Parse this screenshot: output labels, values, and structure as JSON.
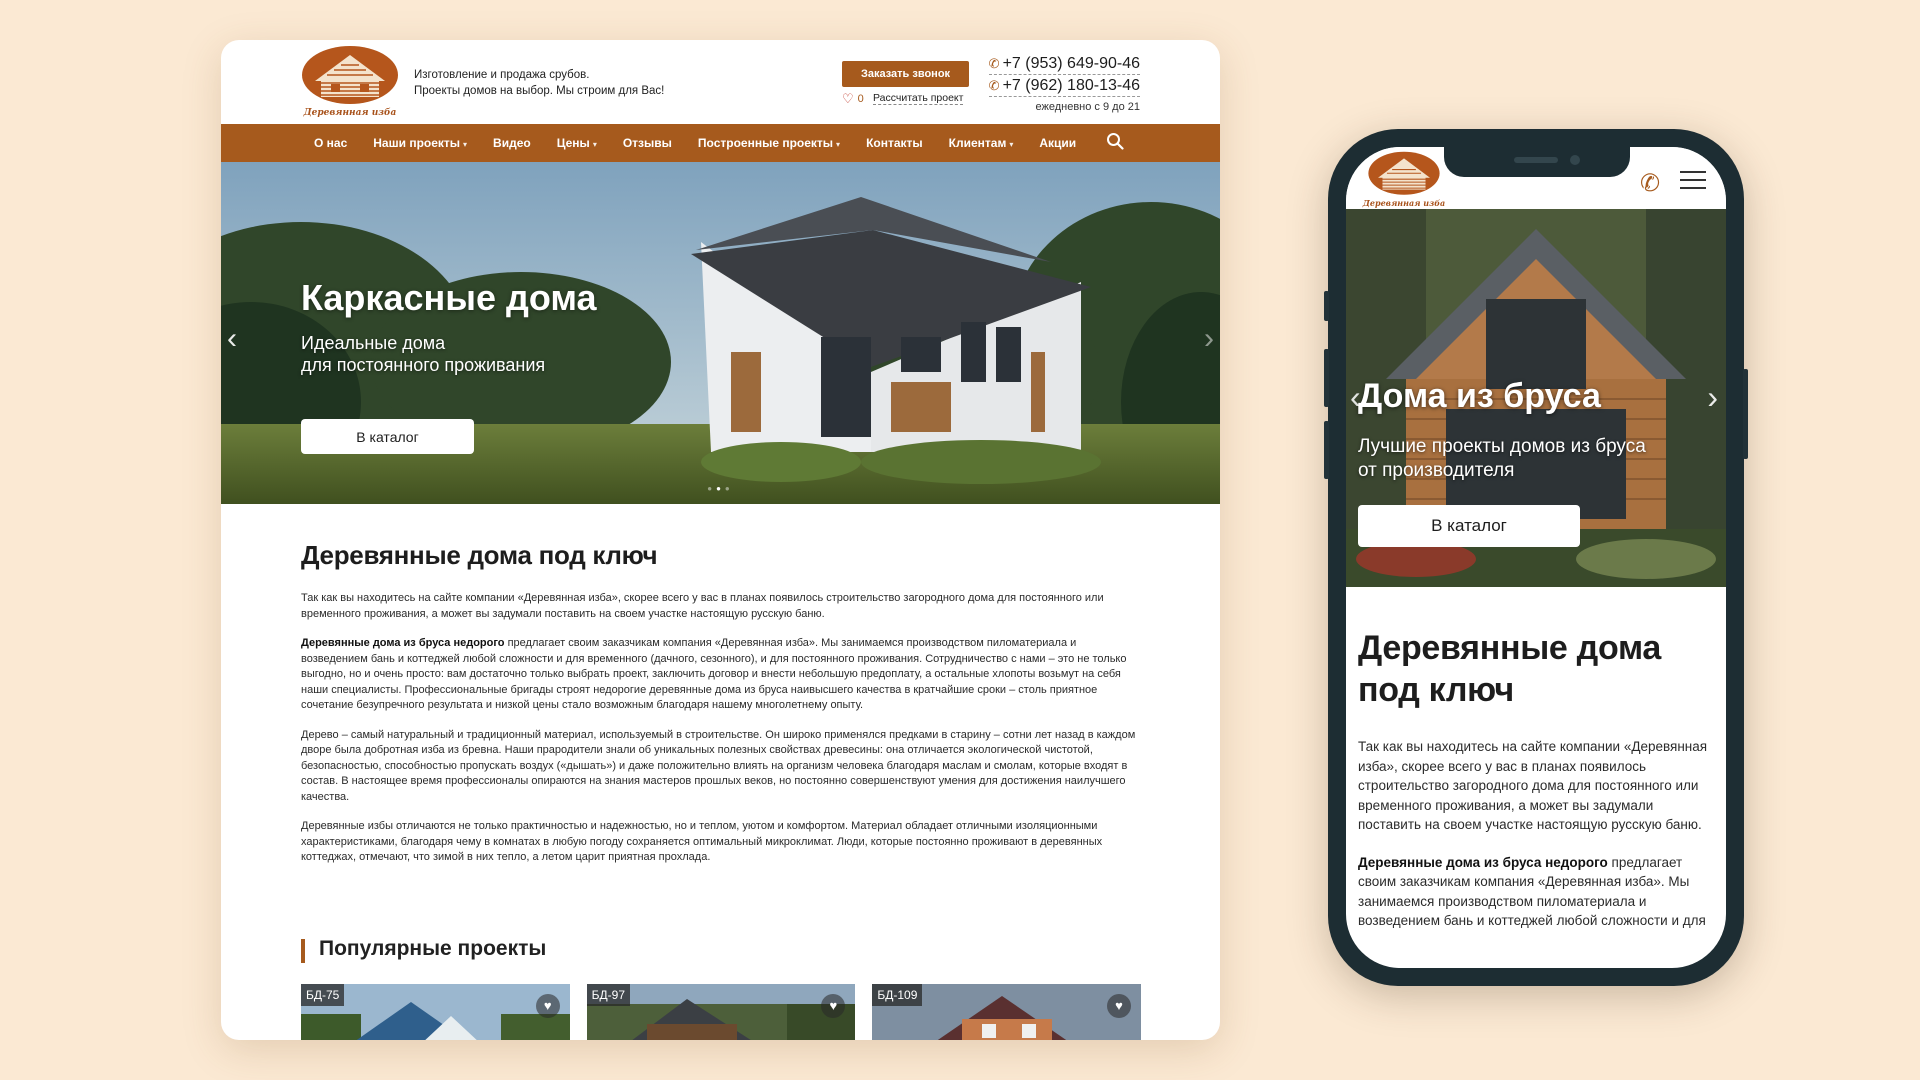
{
  "brand": {
    "name": "Деревянная изба",
    "accent": "#a65a1d",
    "background": "#fbe9d3"
  },
  "header": {
    "tagline_line1": "Изготовление и продажа срубов.",
    "tagline_line2": "Проекты домов на выбор. Мы строим для Вас!",
    "callback_button": "Заказать звонок",
    "favorites_count": "0",
    "calc_link": "Рассчитать проект",
    "phone1": "+7 (953) 649-90-46",
    "phone2": "+7 (962) 180-13-46",
    "hours": "ежедневно с 9 до 21"
  },
  "nav": [
    {
      "label": "О нас",
      "dropdown": false
    },
    {
      "label": "Наши проекты",
      "dropdown": true
    },
    {
      "label": "Видео",
      "dropdown": false
    },
    {
      "label": "Цены",
      "dropdown": true
    },
    {
      "label": "Отзывы",
      "dropdown": false
    },
    {
      "label": "Построенные проекты",
      "dropdown": true
    },
    {
      "label": "Контакты",
      "dropdown": false
    },
    {
      "label": "Клиентам",
      "dropdown": true
    },
    {
      "label": "Акции",
      "dropdown": false
    }
  ],
  "hero": {
    "title": "Каркасные дома",
    "subtitle_line1": "Идеальные дома",
    "subtitle_line2": "для постоянного проживания",
    "button": "В каталог",
    "slide_count": 3,
    "active_slide": 2
  },
  "content": {
    "title": "Деревянные дома под ключ",
    "p1": "Так как вы находитесь на сайте компании «Деревянная изба», скорее всего у вас в планах появилось строительство загородного дома для постоянного или временного проживания, а может вы задумали поставить на своем участке настоящую русскую баню.",
    "p2_bold": "Деревянные дома из бруса недорого",
    "p2_rest": " предлагает своим заказчикам компания «Деревянная изба». Мы занимаемся производством пиломатериала и возведением бань и коттеджей любой сложности и для временного (дачного, сезонного), и для постоянного проживания. Сотрудничество с нами – это не только выгодно, но и очень просто: вам достаточно только выбрать проект, заключить договор и внести небольшую предоплату, а остальные хлопоты возьмут на себя наши специалисты. Профессиональные бригады строят недорогие деревянные дома из бруса наивысшего качества в кратчайшие сроки – столь приятное сочетание безупречного результата и низкой цены стало возможным благодаря нашему многолетнему опыту.",
    "p3": "Дерево – самый натуральный и традиционный материал, используемый в строительстве. Он широко применялся предками в старину – сотни лет назад в каждом дворе была добротная изба из бревна. Наши прародители знали об уникальных полезных свойствах древесины: она отличается экологической чистотой, безопасностью, способностью пропускать воздух («дышать») и даже положительно влиять на организм человека благодаря маслам и смолам, которые входят в состав. В настоящее время профессионалы опираются на знания мастеров прошлых веков, но постоянно совершенствуют умения для достижения наилучшего качества.",
    "p4": "Деревянные избы отличаются не только практичностью и надежностью, но и теплом, уютом и комфортом. Материал обладает отличными изоляционными характеристиками, благодаря чему в комнатах в любую погоду сохраняется оптимальный микроклимат. Люди, которые постоянно проживают в деревянных коттеджах, отмечают, что зимой в них тепло, а летом царит приятная прохлада."
  },
  "popular": {
    "title": "Популярные проекты",
    "cards": [
      {
        "code": "БД-75"
      },
      {
        "code": "БД-97"
      },
      {
        "code": "БД-109"
      }
    ]
  },
  "mobile": {
    "hero_title": "Дома из бруса",
    "hero_subtitle_line1": "Лучшие проекты домов из бруса",
    "hero_subtitle_line2": "от производителя",
    "hero_button": "В каталог",
    "title": "Деревянные дома под ключ",
    "p1": "Так как вы находитесь на сайте компании «Деревянная изба», скорее всего у вас в планах появилось строительство загородного дома для постоянного или временного проживания, а может вы задумали поставить на своем участке настоящую русскую баню.",
    "p2_bold": "Деревянные дома из бруса недорого",
    "p2_rest": " предлагает своим заказчикам компания «Деревянная изба». Мы занимаемся производством пиломатериала и возведением бань и коттеджей любой сложности и для"
  },
  "icons": {
    "phone": "phone-icon",
    "heart": "heart-icon",
    "search": "search-icon",
    "menu": "hamburger-menu-icon",
    "arrow_left": "chevron-left-icon",
    "arrow_right": "chevron-right-icon"
  }
}
